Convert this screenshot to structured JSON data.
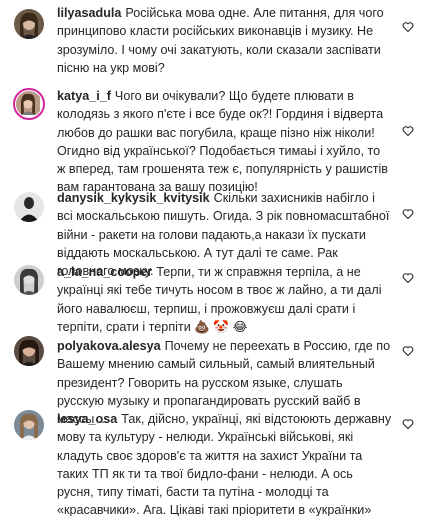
{
  "comments": [
    {
      "username": "lilyasadula",
      "text": "Російська мова одне. Але питання, для чого принципово класти російських виконавців і музику. Не зрозуміло. І чому очі закатують, коли сказали заспівати пісню на укр мові?",
      "liked": false
    },
    {
      "username": "katya_i_f",
      "text": "Чого ви очікували? Що будете плювати в колодязь з якого п'єте і все буде ок?! Гординя і відверта любов до рашки вас погубила, краще пізно ніж ніколи! Огидно від української? Подобається тимаьі і хуйло, то ж вперед, там грошенята теж є, популярність у рашистів вам гарантована за вашу позицію!",
      "liked": false
    },
    {
      "username": "danysik_kykysik_kvitysik",
      "text": "Скільки захисників набігло і всі москальською пишуть. Огида. З рік повномасштабної війни - ракети на голови падають,а накази їх пускати віддають москальською. А тут далі те саме. Рак головного мозку.",
      "liked": false
    },
    {
      "username": "a_la_na_cooper",
      "text": "Терпи, ти ж справжня терпіла, а не українці які тебе тичуть носом в твоє ж лайно, а ти далі його навалюєш, терпиш, і прожовжуєш далі срати і терпіти, срати і терпіти 💩 🤡 😂",
      "liked": false
    },
    {
      "username": "polyakova.alesya",
      "text": "Почему не переехать в Россию, где по Вашему мнению самый сильный, самый влиятельный президент? Говорить на русском языке, слушать русскую музыку и пропагандировать русский вайб в массы ...",
      "liked": false
    },
    {
      "username": "lesya_osa",
      "text": "Так, дійсно, українці, які відстоюють державну мову та культуру - нелюди. Українські військові, які кладуть своє здоров'є та життя на захист України та таких ТП як ти та твої бидло-фани - нелюди. А ось русня, типу тіматі, басти та путіна - молодці та «красавчики». Ага. Цікаві такі пріоритети в «українки» алхім.",
      "liked": false
    }
  ],
  "colors": {
    "text": "#262626",
    "story_ring": "#d6249f"
  },
  "icons": {
    "like": "heart-outline-icon"
  }
}
